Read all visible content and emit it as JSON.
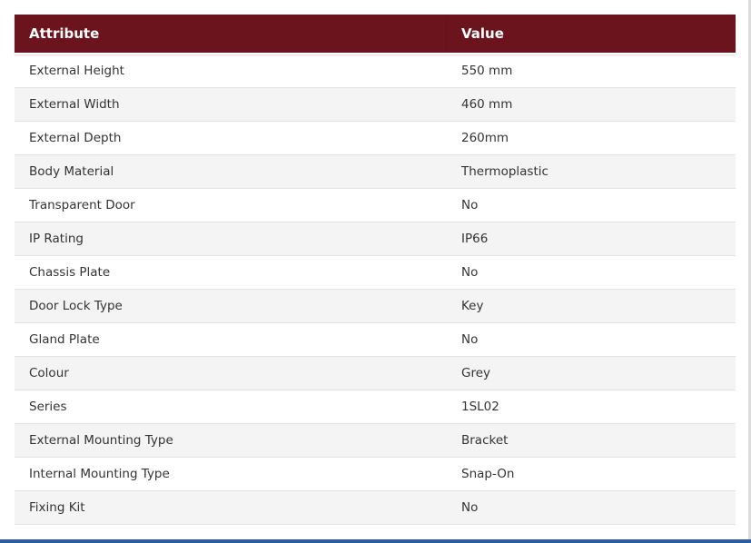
{
  "table": {
    "headers": {
      "attribute": "Attribute",
      "value": "Value"
    },
    "rows": [
      {
        "attribute": "External Height",
        "value": "550 mm"
      },
      {
        "attribute": "External Width",
        "value": "460 mm"
      },
      {
        "attribute": "External Depth",
        "value": "260mm"
      },
      {
        "attribute": "Body Material",
        "value": "Thermoplastic"
      },
      {
        "attribute": "Transparent Door",
        "value": "No"
      },
      {
        "attribute": "IP Rating",
        "value": "IP66"
      },
      {
        "attribute": "Chassis Plate",
        "value": "No"
      },
      {
        "attribute": "Door Lock Type",
        "value": "Key"
      },
      {
        "attribute": "Gland Plate",
        "value": "No"
      },
      {
        "attribute": "Colour",
        "value": "Grey"
      },
      {
        "attribute": "Series",
        "value": "1SL02"
      },
      {
        "attribute": "External Mounting Type",
        "value": "Bracket"
      },
      {
        "attribute": "Internal Mounting Type",
        "value": "Snap-On"
      },
      {
        "attribute": "Fixing Kit",
        "value": "No"
      }
    ]
  },
  "colors": {
    "header_background": "#6b141d",
    "header_text": "#ffffff",
    "row_alt_background": "#f4f4f4",
    "bottom_bar": "#2f5d9e"
  }
}
